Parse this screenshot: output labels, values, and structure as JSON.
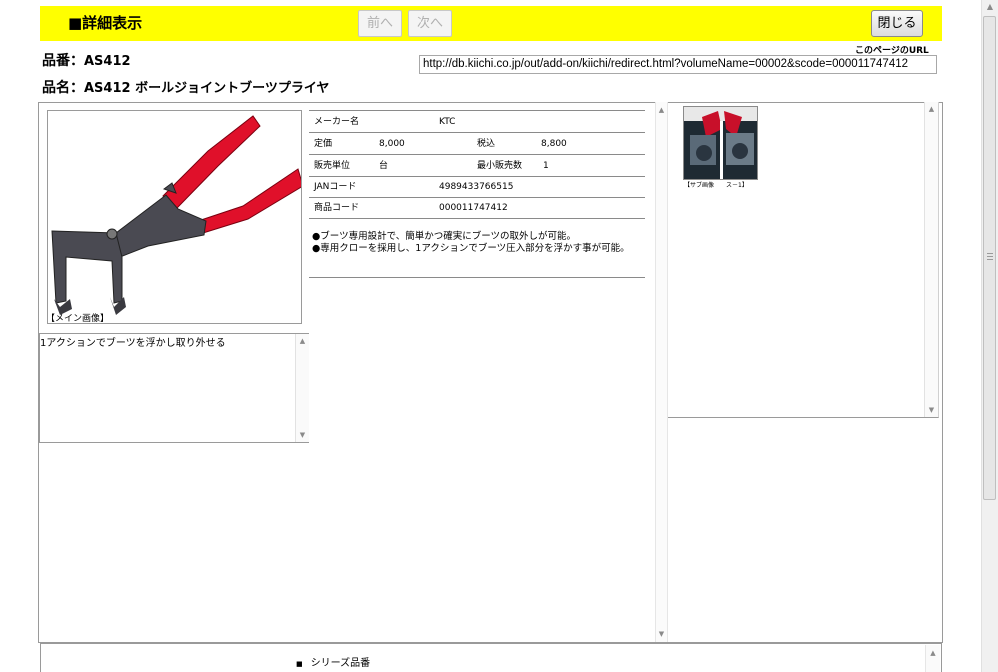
{
  "header": {
    "title": "■詳細表示",
    "prev_label": "前へ",
    "next_label": "次へ",
    "close_label": "閉じる",
    "page_url_label": "このページのURL",
    "page_url": "http://db.kiichi.co.jp/out/add-on/kiichi/redirect.html?volumeName=00002&scode=000011747412"
  },
  "product": {
    "code_label": "品番：",
    "code": "AS412",
    "name_label": "品名：",
    "name": "AS412 ボールジョイントブーツプライヤ"
  },
  "main_image": {
    "caption": "【メイン画像】",
    "colors": {
      "handle": "#e0102a",
      "body": "#4a4a52"
    }
  },
  "description": "1アクションでブーツを浮かし取り外せる",
  "specs": {
    "maker_label": "メーカー名",
    "maker": "KTC",
    "list_price_label": "定価",
    "list_price": "8,000",
    "tax_incl_label": "税込",
    "tax_incl": "8,800",
    "unit_label": "販売単位",
    "unit": "台",
    "min_qty_label": "最小販売数",
    "min_qty": "1",
    "jan_label": "JANコード",
    "jan": "4989433766515",
    "item_code_label": "商品コード",
    "item_code": "000011747412"
  },
  "features": [
    "●ブーツ専用設計で、簡単かつ確実にブーツの取外しが可能。",
    "●専用クローを採用し、1アクションでブーツ圧入部分を浮かす事が可能。"
  ],
  "sub_image": {
    "caption": "【サブ画像　　ス－1】"
  },
  "series": {
    "label": "シリーズ品番"
  }
}
